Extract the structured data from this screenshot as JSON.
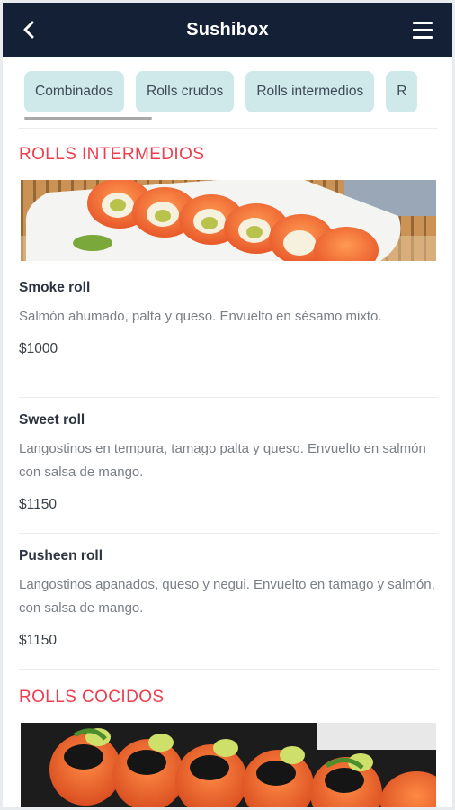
{
  "header": {
    "title": "Sushibox"
  },
  "tabs": [
    {
      "label": "Combinados"
    },
    {
      "label": "Rolls crudos"
    },
    {
      "label": "Rolls intermedios"
    },
    {
      "label": "R"
    }
  ],
  "sections": [
    {
      "title": "ROLLS INTERMEDIOS",
      "items": [
        {
          "name": "Smoke roll",
          "description": "Salmón ahumado, palta y queso. Envuelto en sésamo mixto.",
          "price": "$1000"
        },
        {
          "name": "Sweet roll",
          "description": "Langostinos en tempura, tamago palta y queso. Envuelto en salmón con salsa de mango.",
          "price": "$1150"
        },
        {
          "name": "Pusheen roll",
          "description": "Langostinos apanados, queso y negui. Envuelto en tamago y salmón, con salsa de mango.",
          "price": "$1150"
        }
      ]
    },
    {
      "title": "ROLLS COCIDOS",
      "items": []
    }
  ],
  "colors": {
    "header_bg": "#142036",
    "accent": "#ee3d4f",
    "tab_bg": "#cfe8ea"
  },
  "icons": {
    "back": "chevron-left-icon",
    "menu": "hamburger-menu-icon"
  }
}
